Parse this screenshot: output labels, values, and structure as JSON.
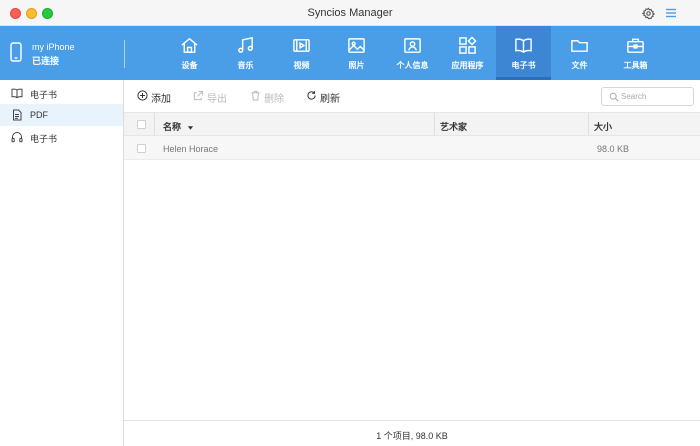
{
  "window": {
    "title": "Syncios Manager"
  },
  "device": {
    "name": "my iPhone",
    "status": "已连接"
  },
  "nav": [
    {
      "label": "设备",
      "icon": "home-icon"
    },
    {
      "label": "音乐",
      "icon": "music-icon"
    },
    {
      "label": "视频",
      "icon": "video-icon"
    },
    {
      "label": "照片",
      "icon": "photo-icon"
    },
    {
      "label": "个人信息",
      "icon": "contact-card-icon"
    },
    {
      "label": "应用程序",
      "icon": "apps-icon"
    },
    {
      "label": "电子书",
      "icon": "book-icon",
      "active": true
    },
    {
      "label": "文件",
      "icon": "folder-icon"
    },
    {
      "label": "工具箱",
      "icon": "toolbox-icon"
    }
  ],
  "sidebar": {
    "items": [
      {
        "label": "电子书",
        "icon": "book-icon"
      },
      {
        "label": "PDF",
        "icon": "document-icon",
        "active": true
      },
      {
        "label": "电子书",
        "icon": "headphones-icon"
      }
    ]
  },
  "toolbar": {
    "add_label": "添加",
    "export_label": "导出",
    "delete_label": "删除",
    "refresh_label": "刷新"
  },
  "search": {
    "placeholder": "Search"
  },
  "table": {
    "columns": {
      "name": "名称",
      "artist": "艺术家",
      "size": "大小"
    },
    "rows": [
      {
        "name": "Helen Horace",
        "artist": "",
        "size": "98.0 KB"
      }
    ]
  },
  "status": {
    "text": "1 个项目, 98.0 KB"
  },
  "colors": {
    "header_blue": "#4a9ee8",
    "active_tab": "#3c86d4",
    "sidebar_active": "#e8f3fb"
  }
}
